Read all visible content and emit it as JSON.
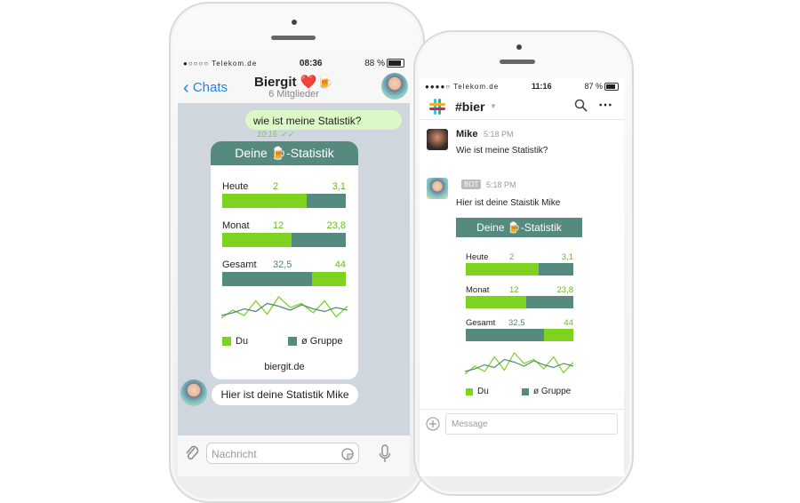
{
  "colors": {
    "accent_green": "#7ed321",
    "accent_teal": "#578a7e",
    "ios_blue": "#2b7fe0",
    "bubble_green": "#dcf8c6"
  },
  "left_phone": {
    "status": {
      "carrier": "●○○○○ Telekom.de",
      "time": "08:36",
      "battery": "88 %"
    },
    "header": {
      "back_label": "Chats",
      "title": "Biergit ❤️🍺",
      "subtitle": "6 Mitglieder"
    },
    "messages": {
      "outgoing_text": "wie ist meine Statistik?",
      "outgoing_time": "10:15",
      "incoming_text": "Hier ist deine Statistik Mike"
    },
    "card": {
      "title": "Deine 🍺-Statistik",
      "rows": [
        {
          "label": "Heute",
          "du_value": "2",
          "group_value": "3,1",
          "du_fraction": 0.68
        },
        {
          "label": "Monat",
          "du_value": "12",
          "group_value": "23,8",
          "du_fraction": 0.56
        },
        {
          "label": "Gesamt",
          "du_value": "32,5",
          "group_value": "44",
          "du_fraction": 0.73
        }
      ],
      "legend": {
        "du": "Du",
        "gruppe": "ø Gruppe"
      },
      "footer": "biergit.de"
    },
    "input": {
      "placeholder": "Nachricht"
    }
  },
  "right_phone": {
    "status": {
      "carrier": "●●●●○ Telekom.de",
      "time": "11:16",
      "battery": "87 %"
    },
    "header": {
      "channel": "#bier"
    },
    "msg1": {
      "name": "Mike",
      "time": "5:18 PM",
      "text": "Wie ist meine Statistik?"
    },
    "msg2": {
      "badge": "BOT",
      "time": "5:18 PM",
      "text": "Hier ist deine Staistik Mike"
    },
    "card": {
      "title": "Deine 🍺-Statistik",
      "rows": [
        {
          "label": "Heute",
          "du_value": "2",
          "group_value": "3,1",
          "du_fraction": 0.68
        },
        {
          "label": "Monat",
          "du_value": "12",
          "group_value": "23,8",
          "du_fraction": 0.56
        },
        {
          "label": "Gesamt",
          "du_value": "32,5",
          "group_value": "44",
          "du_fraction": 0.73
        }
      ],
      "legend": {
        "du": "Du",
        "gruppe": "ø Gruppe"
      }
    },
    "input": {
      "placeholder": "Message"
    }
  },
  "sparkline": {
    "du": [
      3,
      3.6,
      3.2,
      4.3,
      3.3,
      4.6,
      3.8,
      4.1,
      3.4,
      4.3,
      3.1,
      3.9
    ],
    "gruppe": [
      3.2,
      3.4,
      3.7,
      3.5,
      4.1,
      3.9,
      3.6,
      4.0,
      3.7,
      3.5,
      3.8,
      3.6
    ]
  }
}
